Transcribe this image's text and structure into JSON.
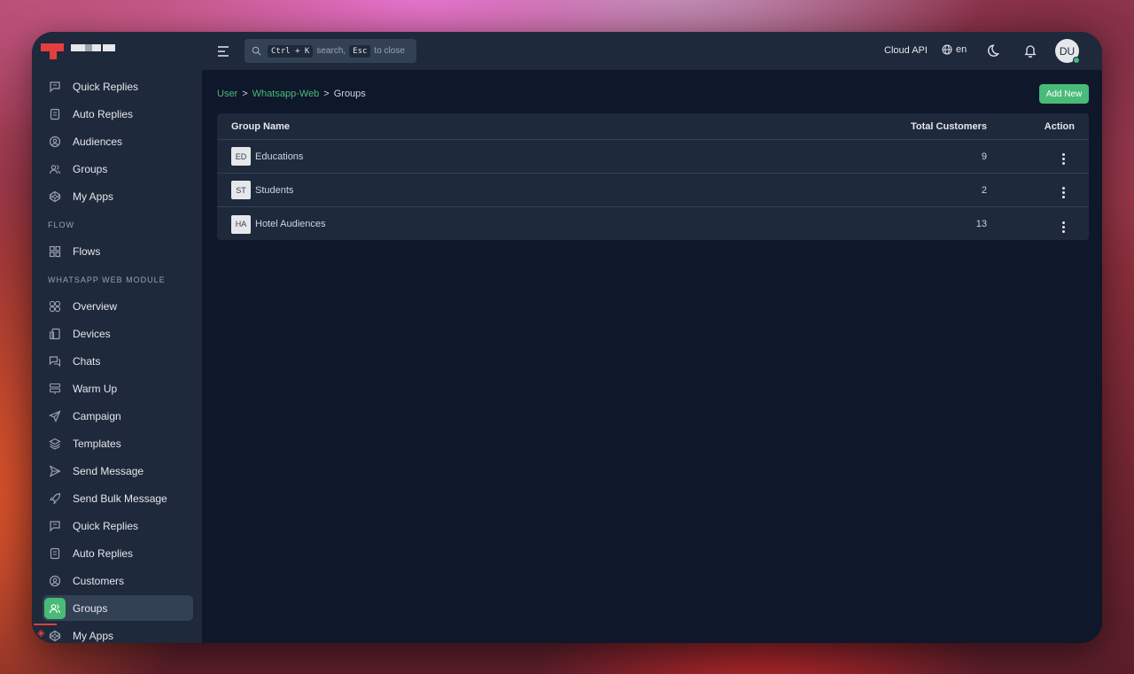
{
  "sidebar": {
    "items_top": [
      {
        "label": "Quick Replies",
        "icon": "message-square-icon"
      },
      {
        "label": "Auto Replies",
        "icon": "file-text-icon"
      },
      {
        "label": "Audiences",
        "icon": "user-circle-icon"
      },
      {
        "label": "Groups",
        "icon": "users-icon"
      },
      {
        "label": "My Apps",
        "icon": "codepen-icon"
      }
    ],
    "section_flow": "FLOW",
    "items_flow": [
      {
        "label": "Flows",
        "icon": "grid-icon"
      }
    ],
    "section_wa": "WHATSAPP WEB MODULE",
    "items_wa": [
      {
        "label": "Overview",
        "icon": "circles-grid-icon"
      },
      {
        "label": "Devices",
        "icon": "devices-icon"
      },
      {
        "label": "Chats",
        "icon": "chats-icon"
      },
      {
        "label": "Warm Up",
        "icon": "server-icon"
      },
      {
        "label": "Campaign",
        "icon": "send-icon"
      },
      {
        "label": "Templates",
        "icon": "layers-icon"
      },
      {
        "label": "Send Message",
        "icon": "play-send-icon"
      },
      {
        "label": "Send Bulk Message",
        "icon": "rocket-icon"
      },
      {
        "label": "Quick Replies",
        "icon": "message-square-icon"
      },
      {
        "label": "Auto Replies",
        "icon": "file-text-icon"
      },
      {
        "label": "Customers",
        "icon": "user-circle-icon"
      },
      {
        "label": "Groups",
        "icon": "users-icon",
        "active": true
      },
      {
        "label": "My Apps",
        "icon": "codepen-icon"
      }
    ]
  },
  "header": {
    "search": {
      "kbd1": "Ctrl + K",
      "text1": "search,",
      "kbd2": "Esc",
      "text2": "to close"
    },
    "cloud_api": "Cloud API",
    "language": "en",
    "avatar": "DU"
  },
  "breadcrumb": [
    {
      "label": "User",
      "link": true
    },
    {
      "label": ">",
      "sep": true
    },
    {
      "label": "Whatsapp-Web",
      "link": true
    },
    {
      "label": ">",
      "sep": true
    },
    {
      "label": "Groups",
      "link": false
    }
  ],
  "add_button": "Add New",
  "table": {
    "headers": {
      "name": "Group Name",
      "total": "Total Customers",
      "action": "Action"
    },
    "rows": [
      {
        "initials": "ED",
        "name": "Educations",
        "total": "9"
      },
      {
        "initials": "ST",
        "name": "Students",
        "total": "2"
      },
      {
        "initials": "HA",
        "name": "Hotel Audiences",
        "total": "13"
      }
    ]
  },
  "colors": {
    "accent": "#48bb78",
    "sidebar_bg": "#1e293b",
    "main_bg": "#0f172a",
    "brand": "#e53e3e"
  }
}
